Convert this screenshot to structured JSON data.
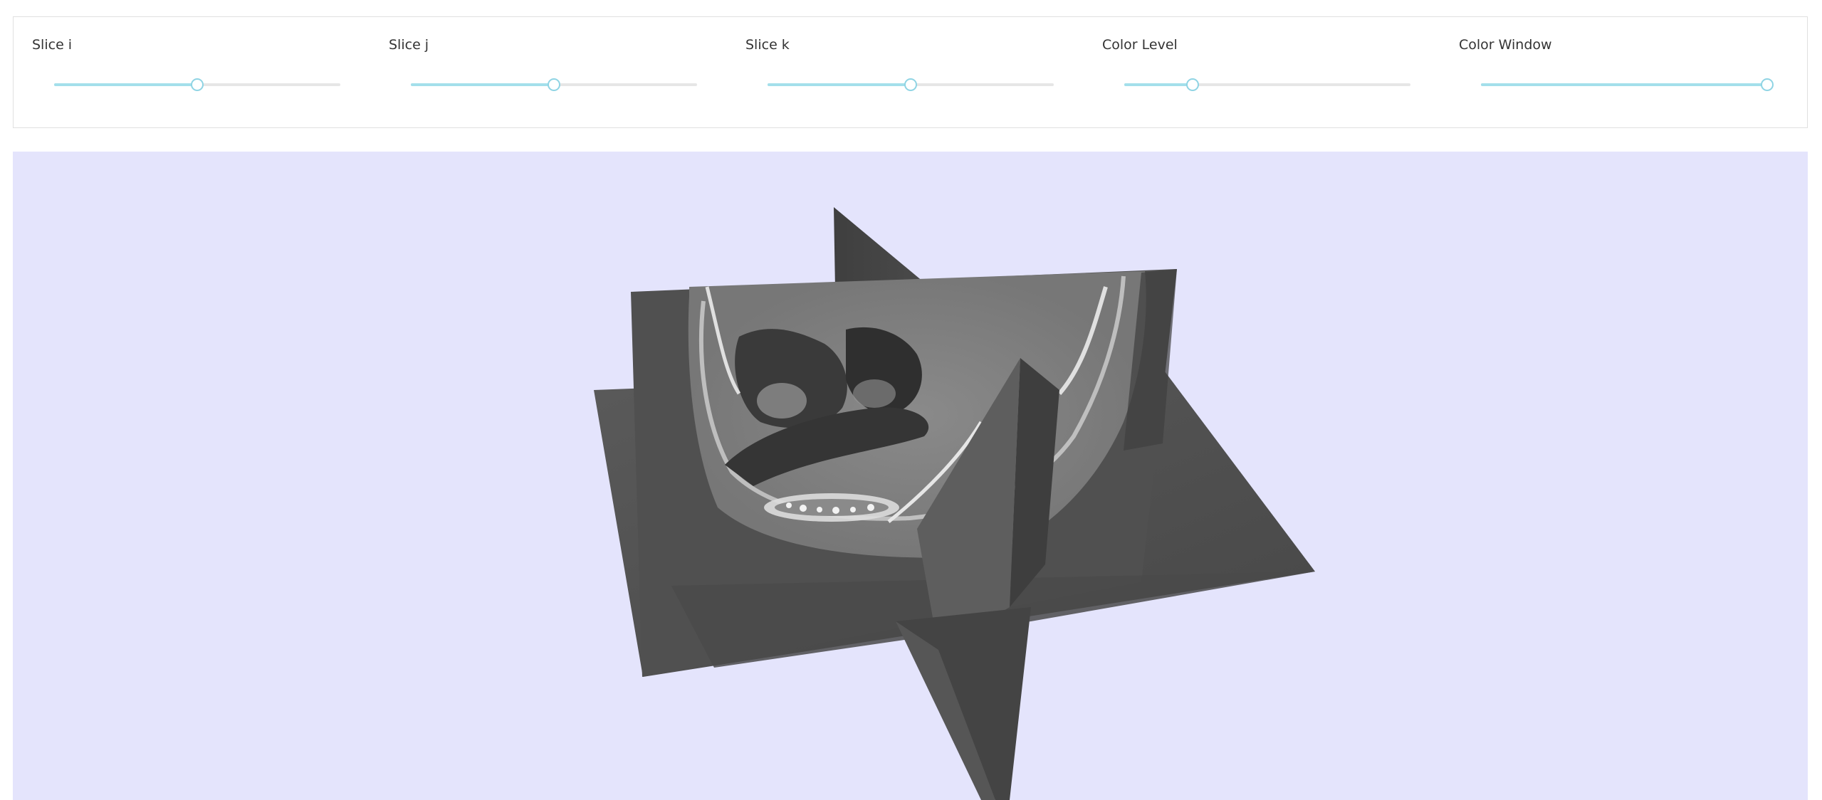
{
  "controls": [
    {
      "label": "Slice i",
      "value": 0.5
    },
    {
      "label": "Slice j",
      "value": 0.5
    },
    {
      "label": "Slice k",
      "value": 0.5
    },
    {
      "label": "Color Level",
      "value": 0.24
    },
    {
      "label": "Color Window",
      "value": 1.0
    }
  ],
  "colors": {
    "viewport_background": "#e4e4fc",
    "slider_track": "#a3dfeb",
    "slider_rail": "#e6e6e6",
    "slider_handle_border": "#8fd4e4"
  }
}
